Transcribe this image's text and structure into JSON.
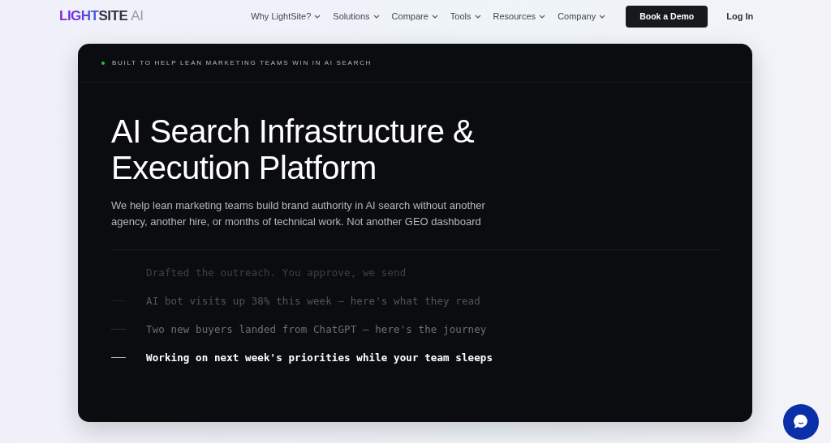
{
  "logo": {
    "parts": [
      {
        "text": "LIGHT",
        "kind": "gradient"
      },
      {
        "text": "SITE",
        "kind": "dark"
      },
      {
        "text": "AI",
        "kind": "muted"
      }
    ]
  },
  "nav": {
    "items": [
      {
        "label": "Why LightSite?"
      },
      {
        "label": "Solutions"
      },
      {
        "label": "Compare"
      },
      {
        "label": "Tools"
      },
      {
        "label": "Resources"
      },
      {
        "label": "Company"
      }
    ],
    "cta": "Book a Demo",
    "login": "Log In"
  },
  "hero": {
    "eyebrow": "BUILT TO HELP LEAN MARKETING TEAMS WIN IN AI SEARCH",
    "title_lines": [
      "AI Search Infrastructure &",
      "Execution Platform"
    ],
    "subtitle": "We help lean marketing teams build brand authority in AI search without another agency, another hire, or months of technical work. Not another GEO dashboard",
    "feed": [
      {
        "text": "Drafted the outreach. You approve, we send",
        "kind": "faint",
        "selected": false
      },
      {
        "text": "AI bot visits up 38% this week — here's what they read",
        "kind": "dim",
        "selected": false
      },
      {
        "text": "Two new buyers landed from ChatGPT — here's the journey",
        "kind": "mid",
        "selected": false
      },
      {
        "text": "Working on next week's priorities while your team sleeps",
        "kind": "bright",
        "selected": true
      }
    ]
  }
}
